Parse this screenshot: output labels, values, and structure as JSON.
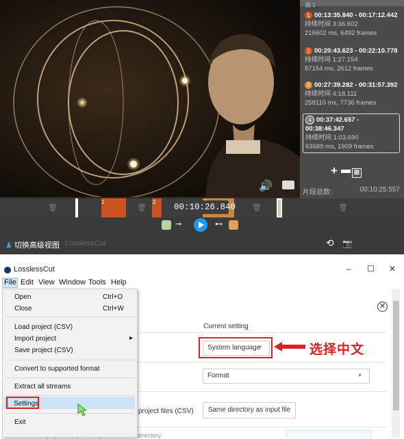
{
  "top": {
    "segments_header": "段 1",
    "segments": [
      {
        "index": "1",
        "range": "00:13:35.840 - 00:17:12.442",
        "duration": "持续时间 3:36.602",
        "detail": "216602 ms, 6492 frames",
        "color": "#e0531c"
      },
      {
        "index": "2",
        "range": "00:20:43.623 - 00:22:10.778",
        "duration": "持续时间 1:27.154",
        "detail": "87154 ms, 2612 frames",
        "color": "#e0531c"
      },
      {
        "index": "3",
        "range": "00:27:39.282 - 00:31:57.392",
        "duration": "持续时间 4:18.111",
        "detail": "258110 ms, 7736 frames",
        "color": "#e08b2c"
      },
      {
        "index": "4",
        "range": "00:37:42.657 - 00:38:46.347",
        "duration": "持续时间 1:03.690",
        "detail": "63689 ms, 1909 frames",
        "color": "#7a7a7a"
      }
    ],
    "total_label": "片段总数:",
    "total_value": "00:10:25.557",
    "timecode": "00:10:26.840",
    "timeline_marks": [
      "1",
      "2",
      "3"
    ],
    "advanced_view_label": "切换高级视图",
    "app_name": "LosslessCut"
  },
  "window": {
    "title": "LosslessCut",
    "controls": {
      "minimize": "–",
      "maximize": "☐",
      "close": "✕"
    },
    "menubar": [
      "File",
      "Edit",
      "View",
      "Window",
      "Tools",
      "Help"
    ],
    "file_menu": [
      {
        "label": "Open",
        "shortcut": "Ctrl+O"
      },
      {
        "label": "Close",
        "shortcut": "Ctrl+W"
      },
      {
        "label": "Load project (CSV)",
        "shortcut": ""
      },
      {
        "label": "Import project",
        "shortcut": "▸"
      },
      {
        "label": "Save project (CSV)",
        "shortcut": ""
      },
      {
        "label": "Convert to supported format",
        "shortcut": ""
      },
      {
        "label": "Extract all streams",
        "shortcut": ""
      },
      {
        "label": "Settings",
        "shortcut": ""
      },
      {
        "label": "Exit",
        "shortcut": ""
      }
    ],
    "settings": {
      "header_current": "Current setting",
      "language_value": "System language",
      "format_value": "Format",
      "project_files_label": "project files (CSV)",
      "directory_button": "Same directory as input file",
      "bottom_partial": "Auto save project file (lossless) in the same directory"
    },
    "annotation_label": "选择中文",
    "accent_red": "#e02020"
  }
}
